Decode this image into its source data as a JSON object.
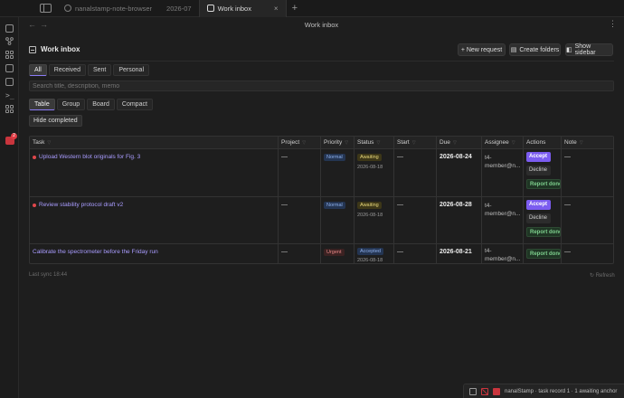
{
  "tabs": [
    {
      "label": "nanalstamp-note-browser",
      "active": false
    },
    {
      "label": "2026-07",
      "active": false
    },
    {
      "label": "Work inbox",
      "active": true
    }
  ],
  "tab_close": "×",
  "new_tab": "+",
  "header": {
    "title": "Work inbox",
    "back": "←",
    "forward": "→",
    "more": "⋮"
  },
  "view": {
    "title": "Work inbox",
    "new_request": "+ New request",
    "create_folders": "Create folders",
    "show_sidebar": "Show sidebar",
    "folders_icon": "folder-icon",
    "sidebar_icon": "sidebar-icon"
  },
  "filters": [
    {
      "label": "All",
      "active": true
    },
    {
      "label": "Received",
      "active": false
    },
    {
      "label": "Sent",
      "active": false
    },
    {
      "label": "Personal",
      "active": false
    }
  ],
  "search": {
    "placeholder": "Search title, description, memo",
    "value": ""
  },
  "views": [
    {
      "label": "Table",
      "active": true
    },
    {
      "label": "Group",
      "active": false
    },
    {
      "label": "Board",
      "active": false
    },
    {
      "label": "Compact",
      "active": false
    }
  ],
  "hide_completed": "Hide completed",
  "table": {
    "columns": [
      "Task",
      "Project",
      "Priority",
      "Status",
      "Start",
      "Due",
      "Assignee",
      "Actions",
      "Note"
    ],
    "rows": [
      {
        "task": "Upload Western blot originals for Fig. 3",
        "flagged": true,
        "project": "—",
        "priority": "Normal",
        "status": "Awaiting",
        "status_date": "2026-08-18",
        "start": "—",
        "due": "2026-08-24",
        "assignee": "t4-\nmember@n...",
        "actions": [
          "Accept",
          "Decline",
          "Report done"
        ],
        "note": "—"
      },
      {
        "task": "Review stability protocol draft v2",
        "flagged": true,
        "project": "—",
        "priority": "Normal",
        "status": "Awaiting",
        "status_date": "2026-08-18",
        "start": "—",
        "due": "2026-08-28",
        "assignee": "t4-\nmember@n...",
        "actions": [
          "Accept",
          "Decline",
          "Report done"
        ],
        "note": "—"
      },
      {
        "task": "Calibrate the spectrometer before the Friday run",
        "flagged": false,
        "project": "—",
        "priority": "Urgent",
        "status": "Accepted",
        "status_date": "2026-08-18",
        "start": "—",
        "due": "2026-08-21",
        "assignee": "t4-\nmember@n...",
        "actions": [
          "Report done"
        ],
        "note": "—"
      }
    ]
  },
  "footer": {
    "last_sync": "Last sync 18:44",
    "refresh": "↻ Refresh"
  },
  "statusbar": {
    "text": "nanalStamp · task record 1 · 1 awaiting anchor"
  },
  "colors": {
    "accent": "#7b5cf0",
    "task_link": "#a99cff",
    "urgent": "#e88787",
    "normal": "#8fb1ee",
    "awaiting": "#e8d77a",
    "flag": "#e0474c"
  }
}
